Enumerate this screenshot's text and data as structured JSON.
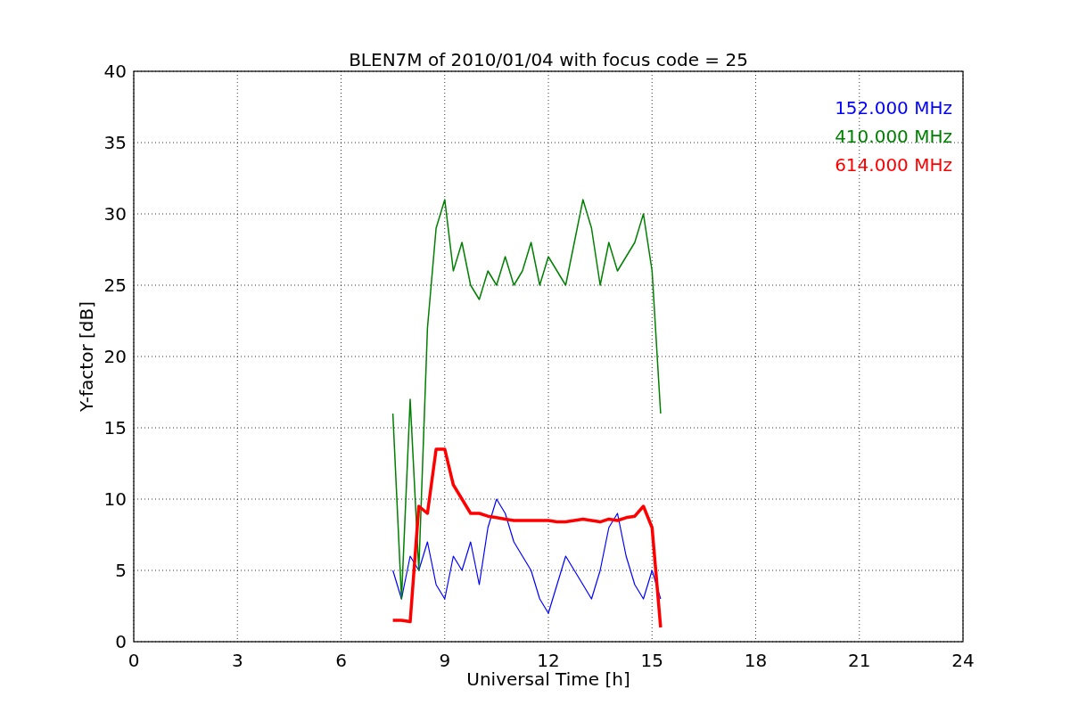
{
  "chart_data": {
    "type": "line",
    "title": "BLEN7M of 2010/01/04 with focus code = 25",
    "xlabel": "Universal Time [h]",
    "ylabel": "Y-factor [dB]",
    "x": [
      7.5,
      7.75,
      8,
      8.25,
      8.5,
      8.75,
      9,
      9.25,
      9.5,
      9.75,
      10,
      10.25,
      10.5,
      10.75,
      11,
      11.25,
      11.5,
      11.75,
      12,
      12.25,
      12.5,
      12.75,
      13,
      13.25,
      13.5,
      13.75,
      14,
      14.25,
      14.5,
      14.75,
      15,
      15.25
    ],
    "series": [
      {
        "name": "152.000 MHz",
        "color": "#0000ff",
        "values": [
          5,
          3,
          6,
          5,
          7,
          4,
          3,
          6,
          5,
          7,
          4,
          8,
          10,
          9,
          7,
          6,
          5,
          3,
          2,
          4,
          6,
          5,
          4,
          3,
          5,
          8,
          9,
          6,
          4,
          3,
          5,
          3
        ]
      },
      {
        "name": "410.000 MHz",
        "color": "#008000",
        "values": [
          16,
          3,
          17,
          5,
          22,
          29,
          31,
          26,
          28,
          25,
          24,
          26,
          25,
          27,
          25,
          26,
          28,
          25,
          27,
          26,
          25,
          28,
          31,
          29,
          25,
          28,
          26,
          27,
          28,
          30,
          26,
          16
        ]
      },
      {
        "name": "614.000 MHz",
        "color": "#ff0000",
        "values": [
          1.5,
          1.5,
          1.4,
          9.5,
          9,
          13.5,
          13.5,
          11,
          10,
          9,
          9,
          8.8,
          8.7,
          8.6,
          8.5,
          8.5,
          8.5,
          8.5,
          8.5,
          8.4,
          8.4,
          8.5,
          8.6,
          8.5,
          8.4,
          8.6,
          8.5,
          8.7,
          8.8,
          9.5,
          8,
          1
        ]
      }
    ],
    "xlim": [
      0,
      24
    ],
    "ylim": [
      0,
      40
    ],
    "xticks": [
      0,
      3,
      6,
      9,
      12,
      15,
      18,
      21,
      24
    ],
    "yticks": [
      0,
      5,
      10,
      15,
      20,
      25,
      30,
      35,
      40
    ],
    "grid": true
  }
}
